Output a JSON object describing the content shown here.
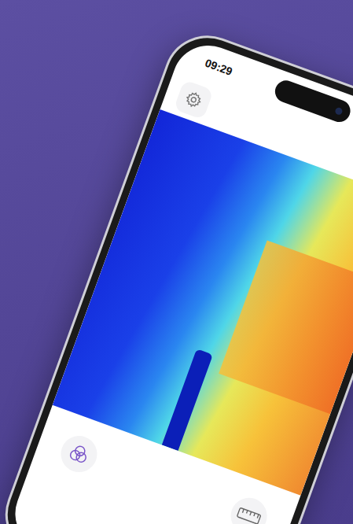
{
  "status_bar": {
    "time": "09:29"
  }
}
